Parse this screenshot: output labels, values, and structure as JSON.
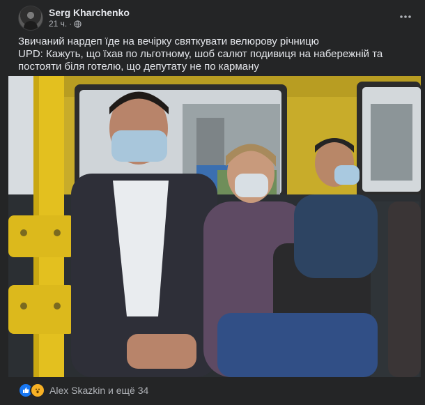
{
  "post": {
    "author": "Serg Kharchenko",
    "time": "21 ч.",
    "separator": "·",
    "text_lines": [
      "Звичаний нардеп їде на вечірку святкувати велюрову річницю",
      "UPD: Кажуть, що їхав по льготному, шоб салют подивиця на набережній та постояти біля готелю, що депутату не по карману"
    ],
    "photo_icon": "photo-bus-passengers",
    "more_icon": "more-options-icon"
  },
  "reactions": {
    "icons": [
      "like-icon",
      "wow-icon"
    ],
    "summary": "Alex Skazkin и ещё 34"
  },
  "colors": {
    "background": "#242526",
    "text": "#e4e6eb",
    "secondary": "#b0b3b8",
    "like": "#1877f2",
    "wow": "#f7b125"
  }
}
